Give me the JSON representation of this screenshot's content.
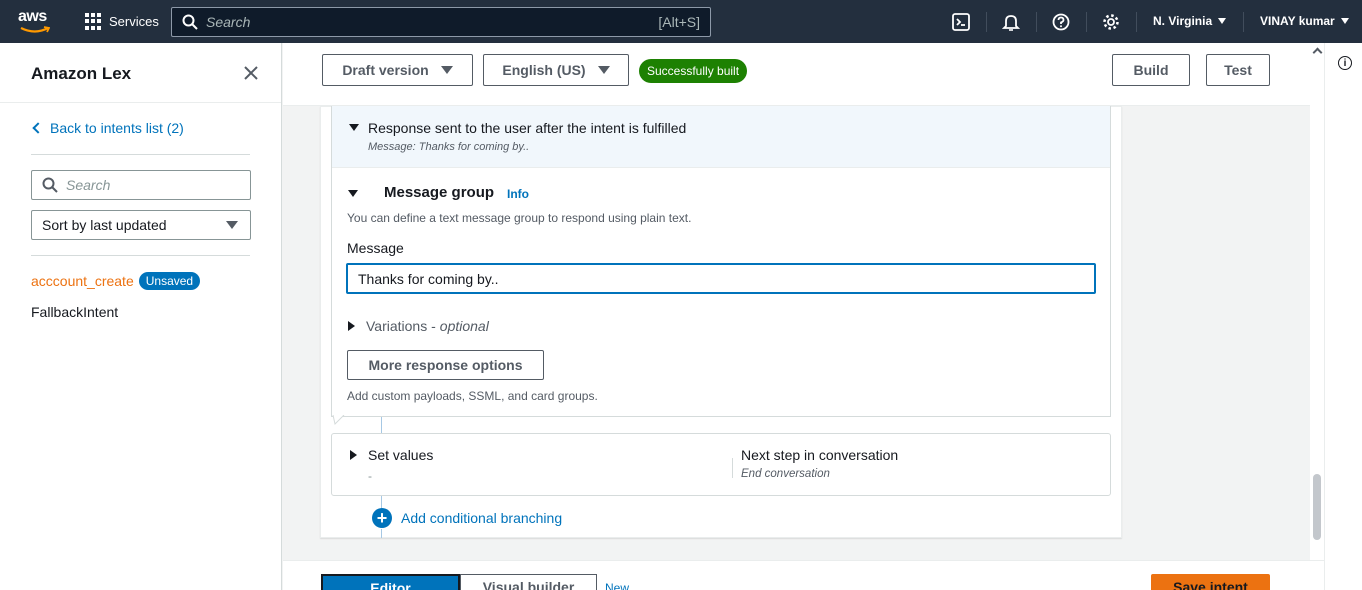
{
  "topbar": {
    "logo_text": "aws",
    "services_label": "Services",
    "search_placeholder": "Search",
    "search_shortcut": "[Alt+S]",
    "region": "N. Virginia",
    "user": "VINAY kumar"
  },
  "sidepanel": {
    "title": "Amazon Lex",
    "back_link": "Back to intents list (2)",
    "search_placeholder": "Search",
    "sort_label": "Sort by last updated",
    "intents": [
      {
        "name": "acccount_create",
        "badge": "Unsaved"
      },
      {
        "name": "FallbackIntent"
      }
    ]
  },
  "toolbar": {
    "version_label": "Draft version",
    "language_label": "English (US)",
    "status_badge": "Successfully built",
    "build_label": "Build",
    "test_label": "Test"
  },
  "response": {
    "heading": "Response sent to the user after the intent is fulfilled",
    "summary": "Message: Thanks for coming by..",
    "group_title": "Message group",
    "info_link": "Info",
    "group_description": "You can define a text message group to respond using plain text.",
    "message_label": "Message",
    "message_value": "Thanks for coming by..",
    "variations_label": "Variations - ",
    "variations_optional": "optional",
    "more_options_label": "More response options",
    "more_options_hint": "Add custom payloads, SSML, and card groups."
  },
  "set_values": {
    "label": "Set values",
    "value": "-",
    "next_step_label": "Next step in conversation",
    "next_step_value": "End conversation"
  },
  "branching": {
    "add_label": "Add conditional branching"
  },
  "bottom": {
    "editor_tab": "Editor",
    "visual_tab": "Visual builder",
    "new_label": "New",
    "save_label": "Save intent"
  },
  "colors": {
    "topbar_bg": "#232f3e",
    "link_blue": "#0073bb",
    "success_green": "#1d8102",
    "accent_orange": "#ec7211"
  }
}
